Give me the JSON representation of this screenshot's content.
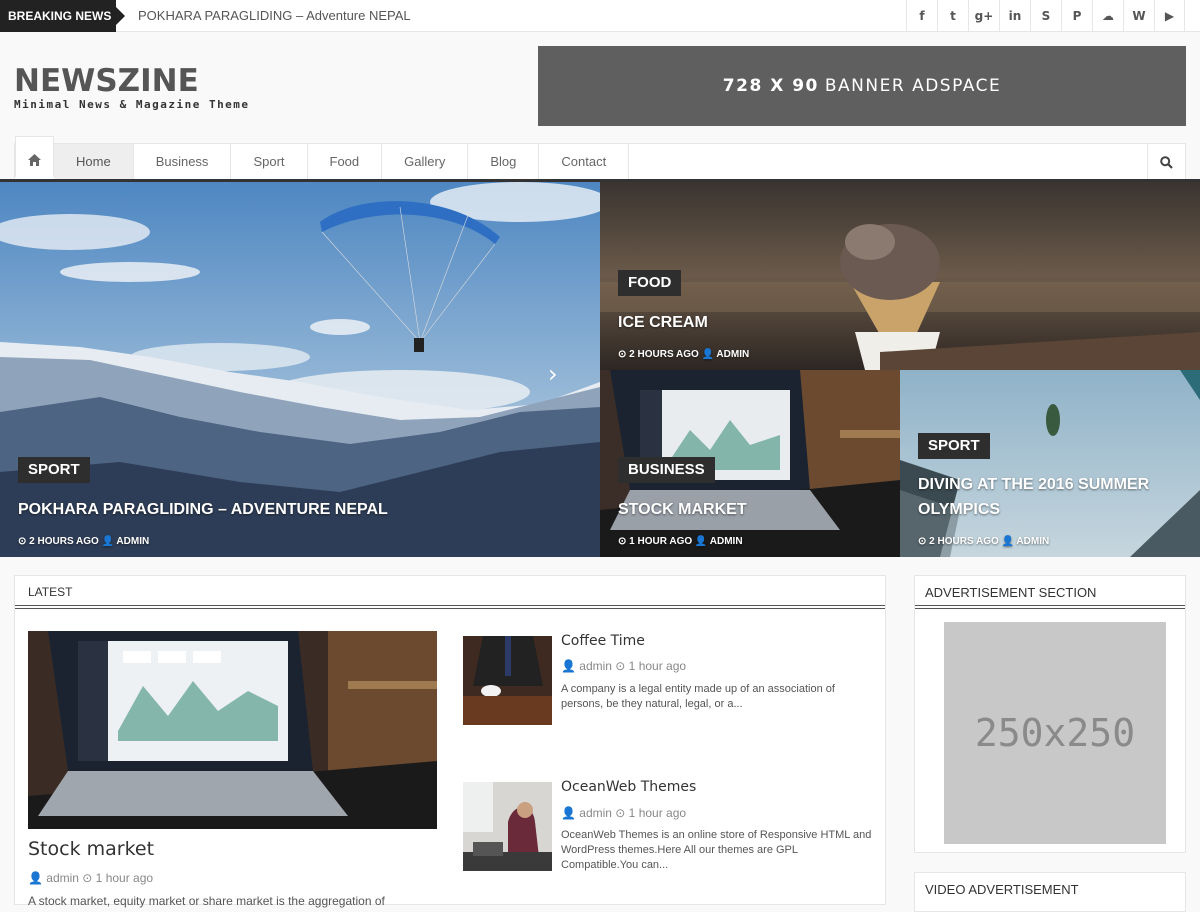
{
  "breaking": {
    "label": "BREAKING NEWS",
    "text": "POKHARA PARAGLIDING – Adventure NEPAL"
  },
  "social": [
    {
      "name": "facebook-icon",
      "glyph": "f"
    },
    {
      "name": "twitter-icon",
      "glyph": "t"
    },
    {
      "name": "google-plus-icon",
      "glyph": "g+"
    },
    {
      "name": "linkedin-icon",
      "glyph": "in"
    },
    {
      "name": "skype-icon",
      "glyph": "S"
    },
    {
      "name": "pinterest-icon",
      "glyph": "P"
    },
    {
      "name": "soundcloud-icon",
      "glyph": "☁"
    },
    {
      "name": "whatsapp-icon",
      "glyph": "W"
    },
    {
      "name": "youtube-icon",
      "glyph": "▶"
    }
  ],
  "site": {
    "title": "NEWSZINE",
    "tagline": "Minimal News & Magazine Theme"
  },
  "banner": {
    "size": "728 X 90",
    "label": "BANNER ADSPACE"
  },
  "nav": {
    "items": [
      "Home",
      "Business",
      "Sport",
      "Food",
      "Gallery",
      "Blog",
      "Contact"
    ],
    "active": "Home"
  },
  "hero": {
    "main": {
      "category": "SPORT",
      "title": "POKHARA PARAGLIDING – ADVENTURE NEPAL",
      "meta": "⊙ 2 HOURS AGO 👤 ADMIN"
    },
    "top_right": {
      "category": "FOOD",
      "title": "ICE CREAM",
      "meta": "⊙ 2 HOURS AGO 👤 ADMIN"
    },
    "bottom_mid": {
      "category": "BUSINESS",
      "title": "STOCK MARKET",
      "meta": "⊙ 1 HOUR AGO 👤 ADMIN"
    },
    "bottom_right": {
      "category": "SPORT",
      "title_line1": "DIVING AT THE 2016 SUMMER",
      "title_line2": "OLYMPICS",
      "meta": "⊙ 2 HOURS AGO 👤 ADMIN"
    }
  },
  "latest": {
    "heading": "LATEST",
    "big": {
      "title": "Stock market",
      "meta": "👤 admin ⊙ 1 hour ago",
      "excerpt": "A stock market, equity market or share market is the aggregation of"
    },
    "items": [
      {
        "title": "Coffee Time",
        "meta": "👤 admin ⊙ 1 hour ago",
        "excerpt_line1": "A company is a legal entity made up of an association of",
        "excerpt_line2": "persons, be they natural, legal, or a..."
      },
      {
        "title": "OceanWeb Themes",
        "meta": "👤 admin ⊙ 1 hour ago",
        "excerpt_line1": "OceanWeb Themes is an online store of Responsive HTML and",
        "excerpt_line2": "WordPress themes.Here All our themes are GPL",
        "excerpt_line3": "Compatible.You can..."
      }
    ]
  },
  "sidebar": {
    "ad_heading": "ADVERTISEMENT SECTION",
    "ad_size": "250x250",
    "video_heading": "VIDEO ADVERTISEMENT"
  }
}
